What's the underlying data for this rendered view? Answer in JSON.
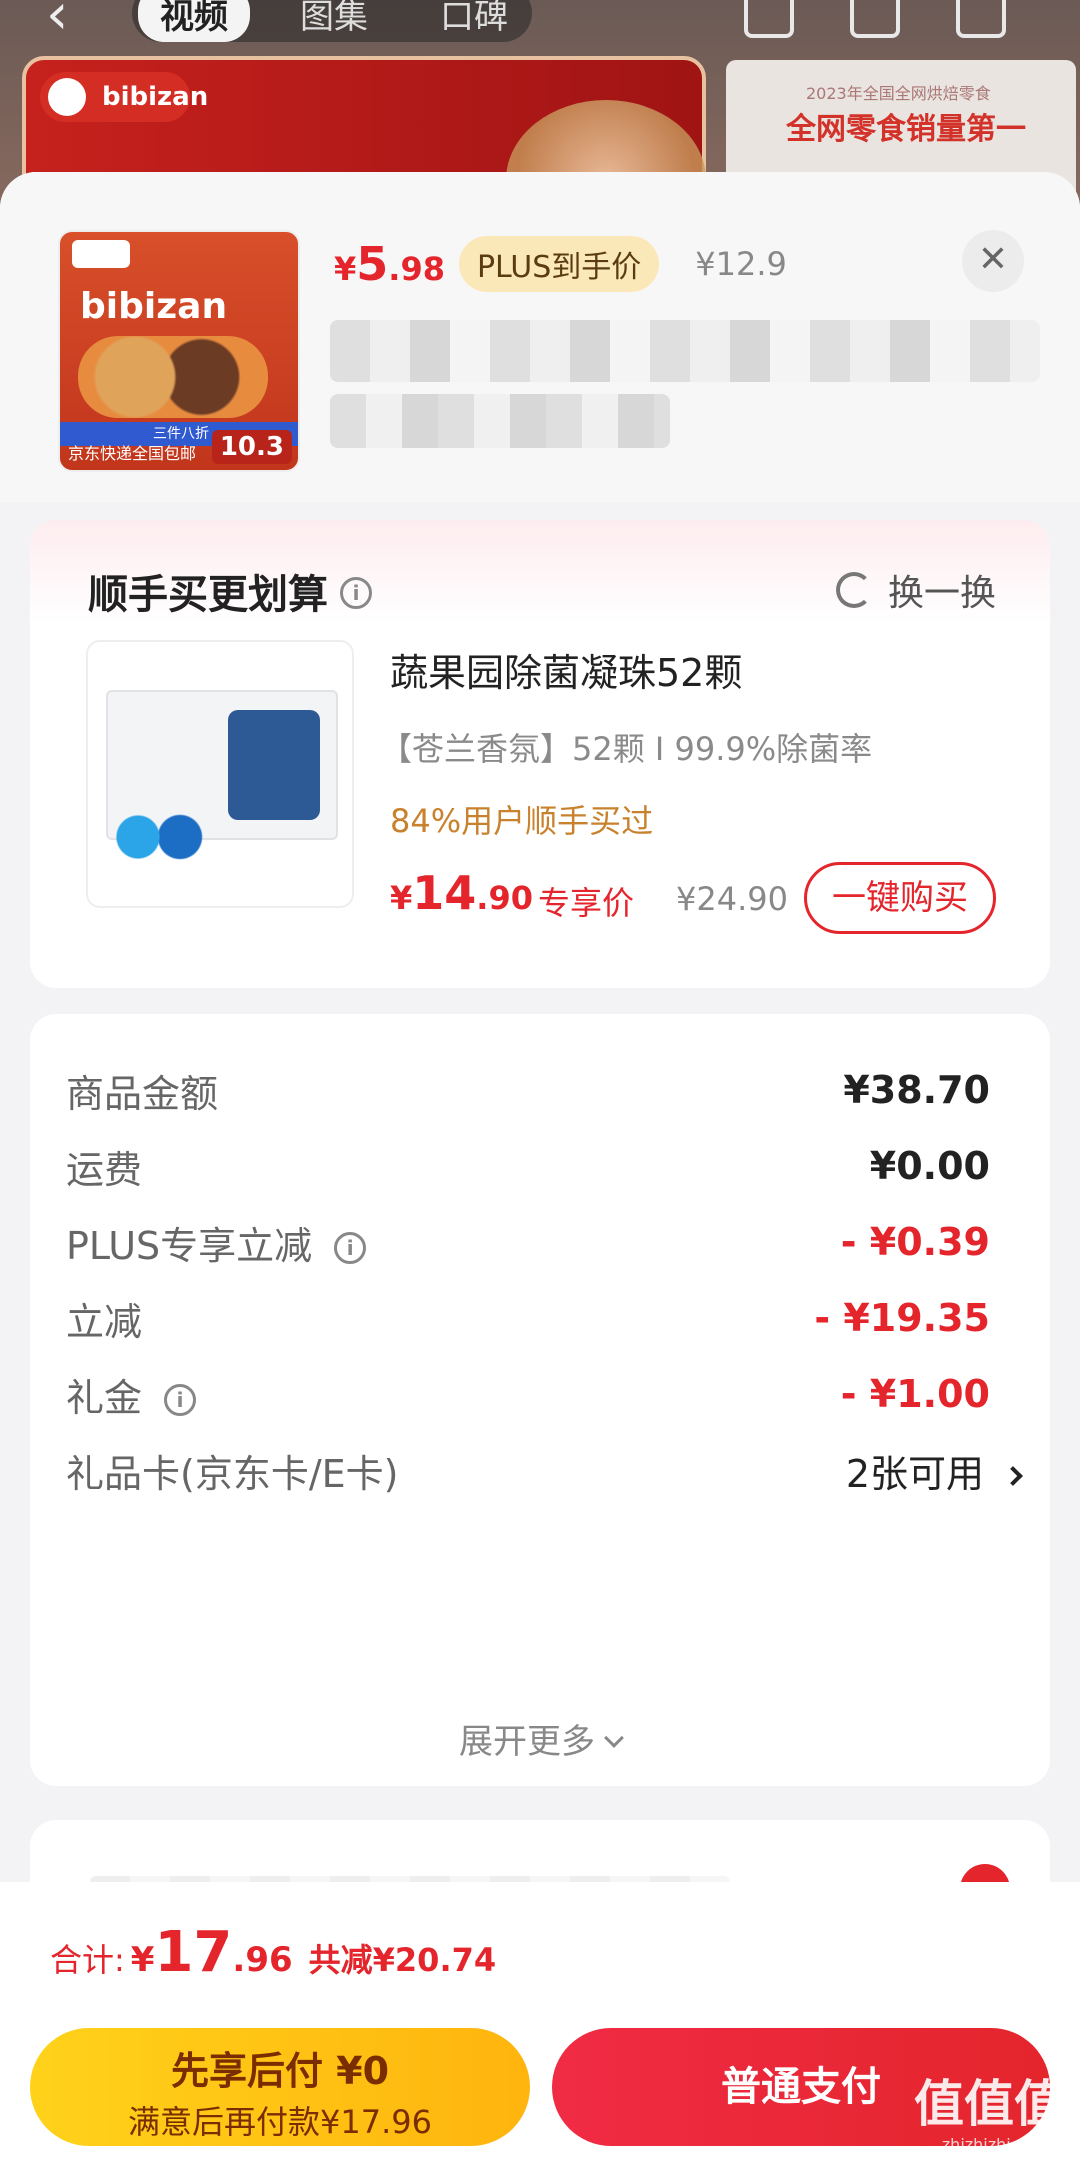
{
  "background": {
    "tabs": [
      "视频",
      "图集",
      "口碑"
    ],
    "logo_text": "bibizan",
    "banner_text": "全网零食销量第一",
    "banner_small": "2023年全国全网烘焙零食"
  },
  "product": {
    "image_brand": "bibizan",
    "image_stripe": "三件八折",
    "image_shipping": "京东快递全国包邮",
    "image_badge": "10.3",
    "price_symbol": "¥",
    "price_int": "5",
    "price_dec": ".98",
    "plus_label": "PLUS到手价",
    "original_price": "¥12.9",
    "close_icon": "close-icon"
  },
  "upsell": {
    "title": "顺手买更划算",
    "refresh_label": "换一换",
    "item": {
      "name": "蔬果园除菌凝珠52颗",
      "desc": "【苍兰香氛】52颗 I 99.9%除菌率",
      "bought": "84%用户顺手买过",
      "price_symbol": "¥",
      "price_int": "14",
      "price_dec": ".90",
      "price_label": "专享价",
      "original_price": "¥24.90",
      "buy_label": "一键购买"
    }
  },
  "summary": {
    "rows": [
      {
        "label": "商品金额",
        "value": "¥38.70"
      },
      {
        "label": "运费",
        "value": "¥0.00"
      },
      {
        "label": "PLUS专享立减",
        "value": "- ¥0.39"
      },
      {
        "label": "立减",
        "value": "- ¥19.35"
      },
      {
        "label": "礼金",
        "value": "- ¥1.00"
      },
      {
        "label": "礼品卡(京东卡/E卡)",
        "value": "2张可用"
      }
    ],
    "expand_label": "展开更多"
  },
  "footer": {
    "total_label": "合计:",
    "total_symbol": "¥",
    "total_int": "17",
    "total_dec": ".96",
    "saved": "共减¥20.74",
    "pay_later_line1": "先享后付 ¥0",
    "pay_later_line2": "满意后再付款¥17.96",
    "pay_label": "普通支付",
    "watermark": "值值值",
    "watermark_sub": "zhizhizhi.com"
  },
  "colors": {
    "accent_red": "#e4252c",
    "plus_gold": "#fbe8b8",
    "pay_later_yellow": "#ffc414",
    "bought_orange": "#c8812c"
  }
}
